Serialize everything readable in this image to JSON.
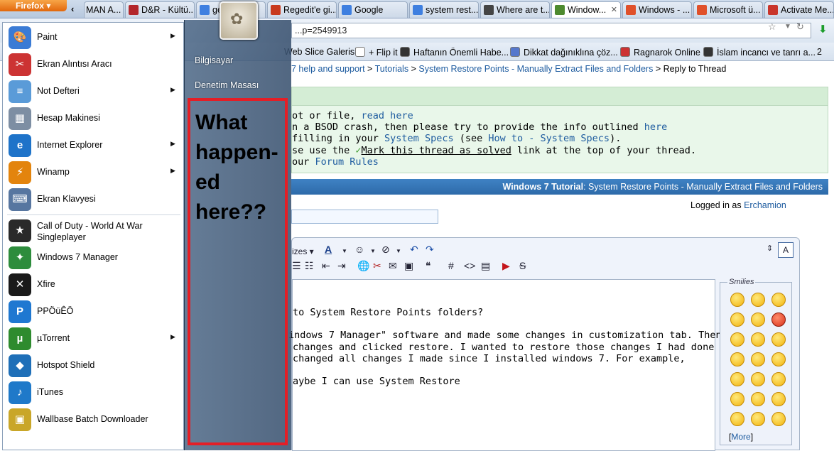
{
  "browser": {
    "app_button": "Firefox",
    "tabs": [
      {
        "label": "MAN A...",
        "color": "#c13a2a",
        "icon": "page-icon"
      },
      {
        "label": "D&R - Kültü...",
        "color": "#b3262b",
        "icon": "dr-icon"
      },
      {
        "label": "ge...",
        "color": "#3e7fe0",
        "icon": "google-icon"
      },
      {
        "label": "Regedit'e gi...",
        "color": "#c83a1e",
        "icon": "page-icon"
      },
      {
        "label": "Google",
        "color": "#3e7fe0",
        "icon": "google-icon"
      },
      {
        "label": "system rest...",
        "color": "#3e7fe0",
        "icon": "google-icon"
      },
      {
        "label": "Where are t...",
        "color": "#444",
        "icon": "page-icon"
      },
      {
        "label": "Window...",
        "color": "#4d8a2f",
        "icon": "sevenforums-icon"
      },
      {
        "label": "Windows - ...",
        "color": "#e0502a",
        "icon": "microsoft-icon"
      },
      {
        "label": "Microsoft ü...",
        "color": "#e0502a",
        "icon": "microsoft-icon"
      },
      {
        "label": "Activate Me...",
        "color": "#c9352b",
        "icon": "gmail-icon"
      }
    ],
    "url": "...p=2549913",
    "bookmarks": [
      {
        "label": "Web Slice Galerisi"
      },
      {
        "label": "+ Flip it"
      },
      {
        "label": "Haftanın Önemli Habe..."
      },
      {
        "label": "Dikkat dağınıklına çöz..."
      },
      {
        "label": "Ragnarok Online"
      },
      {
        "label": "İslam incancı ve tanrı a..."
      },
      {
        "label": "2"
      }
    ]
  },
  "page": {
    "breadcrumb": {
      "link1": "7 help and support",
      "sep": ">",
      "link2": "Tutorials",
      "link3": "System Restore Points - Manually Extract Files and Folders",
      "current": "Reply to Thread"
    },
    "notice": {
      "line1_text": "ot or file, ",
      "line1_link": "read here",
      "line2_text": "n a BSOD crash, then please try to provide the info outlined ",
      "line2_link": "here",
      "line3_text": "filling in your ",
      "line3_link1": "System Specs",
      "line3_mid": " (see ",
      "line3_link2": "How to - System Specs",
      "line3_end": ").",
      "line4_text": "se use the ",
      "line4_link": "Mark this thread as solved",
      "line4_end": " link at the top of your thread.",
      "line5_text": "our ",
      "line5_link": "Forum Rules"
    },
    "post_bar": {
      "bold": "Windows 7 Tutorial",
      "title": ": System Restore Points - Manually Extract Files and Folders"
    },
    "logged_in_label": "Logged in as ",
    "logged_in_user": "Erchamion",
    "editor": {
      "size_label": "izes",
      "lines": [
        "to System Restore Points folders?",
        "indows 7 Manager\" software and made some changes in customization tab. Then I",
        "changes and clicked restore. I wanted to restore those changes I had done with it,",
        "changed all changes I made since I installed windows 7. For example,",
        "aybe I can use System Restore"
      ]
    },
    "smilies": {
      "legend": "Smilies",
      "more_label": "More"
    }
  },
  "start_menu": {
    "items": [
      {
        "label": "Paint",
        "arrow": true,
        "icon": "paint-icon",
        "color": "#3a7bd5",
        "glyph": "🎨"
      },
      {
        "label": "Ekran Alıntısı Aracı",
        "arrow": false,
        "icon": "snipping-tool-icon",
        "color": "#cc3333",
        "glyph": "✂"
      },
      {
        "label": "Not Defteri",
        "arrow": true,
        "icon": "notepad-icon",
        "color": "#5a9bd8",
        "glyph": "≡"
      },
      {
        "label": "Hesap Makinesi",
        "arrow": false,
        "icon": "calculator-icon",
        "color": "#7d8ea3",
        "glyph": "▦"
      },
      {
        "label": "Internet Explorer",
        "arrow": true,
        "icon": "internet-explorer-icon",
        "color": "#1e73c9",
        "glyph": "e"
      },
      {
        "label": "Winamp",
        "arrow": true,
        "icon": "winamp-icon",
        "color": "#e3840d",
        "glyph": "⚡"
      },
      {
        "label": "Ekran Klavyesi",
        "arrow": false,
        "icon": "keyboard-icon",
        "color": "#5776a0",
        "glyph": "⌨"
      },
      {
        "label": "Call of Duty - World At War Singleplayer",
        "arrow": false,
        "icon": "call-of-duty-icon",
        "color": "#2a2a2a",
        "glyph": "★"
      },
      {
        "label": "Windows 7 Manager",
        "arrow": false,
        "icon": "windows-7-manager-icon",
        "color": "#2d8c3c",
        "glyph": "✦"
      },
      {
        "label": "Xfire",
        "arrow": false,
        "icon": "xfire-icon",
        "color": "#1a1a1a",
        "glyph": "✕"
      },
      {
        "label": "PPÖüÊÖ",
        "arrow": false,
        "icon": "pps-icon",
        "color": "#1f78d1",
        "glyph": "P"
      },
      {
        "label": "µTorrent",
        "arrow": true,
        "icon": "utorrent-icon",
        "color": "#2e8b2e",
        "glyph": "µ"
      },
      {
        "label": "Hotspot Shield",
        "arrow": false,
        "icon": "hotspot-shield-icon",
        "color": "#1e6fb8",
        "glyph": "◆"
      },
      {
        "label": "iTunes",
        "arrow": false,
        "icon": "itunes-icon",
        "color": "#1f79c9",
        "glyph": "♪"
      },
      {
        "label": "Wallbase Batch Downloader",
        "arrow": false,
        "icon": "wallbase-icon",
        "color": "#c9a628",
        "glyph": "▣"
      }
    ],
    "right_items": [
      "Bilgisayar",
      "Denetim Masası"
    ],
    "annotation": "What happen-ed here??"
  }
}
